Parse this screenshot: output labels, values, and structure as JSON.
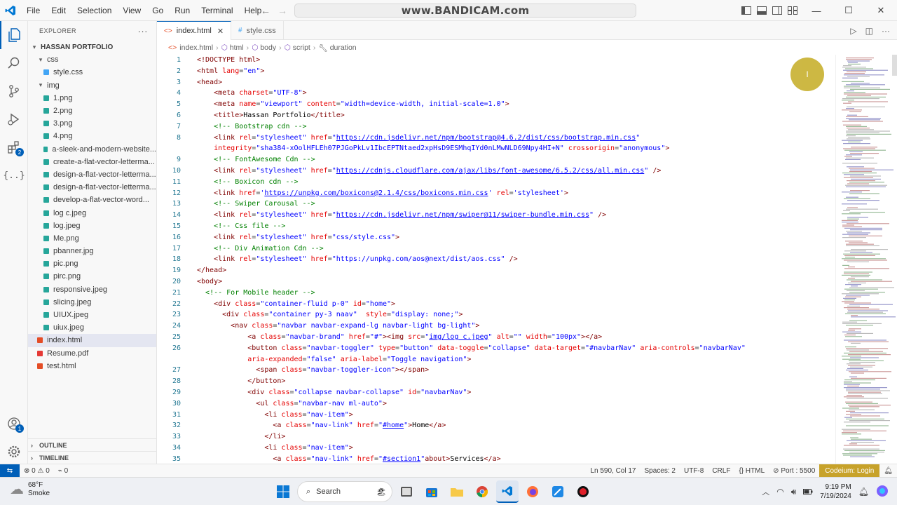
{
  "menu": [
    "File",
    "Edit",
    "Selection",
    "View",
    "Go",
    "Run",
    "Terminal",
    "Help"
  ],
  "watermark": "www.BANDICAM.com",
  "explorer": {
    "title": "EXPLORER",
    "project": "HASSAN PORTFOLIO",
    "tree": [
      {
        "label": "css",
        "type": "folder",
        "depth": 1
      },
      {
        "label": "style.css",
        "type": "css",
        "depth": 2
      },
      {
        "label": "img",
        "type": "folder",
        "depth": 1
      },
      {
        "label": "1.png",
        "type": "img",
        "depth": 2
      },
      {
        "label": "2.png",
        "type": "img",
        "depth": 2
      },
      {
        "label": "3.png",
        "type": "img",
        "depth": 2
      },
      {
        "label": "4.png",
        "type": "img",
        "depth": 2
      },
      {
        "label": "a-sleek-and-modern-website...",
        "type": "img",
        "depth": 2
      },
      {
        "label": "create-a-flat-vector-letterma...",
        "type": "img",
        "depth": 2
      },
      {
        "label": "design-a-flat-vector-letterma...",
        "type": "img",
        "depth": 2
      },
      {
        "label": "design-a-flat-vector-letterma...",
        "type": "img",
        "depth": 2
      },
      {
        "label": "develop-a-flat-vector-word...",
        "type": "img",
        "depth": 2
      },
      {
        "label": "log c.jpeg",
        "type": "img",
        "depth": 2
      },
      {
        "label": "log.jpeg",
        "type": "img",
        "depth": 2
      },
      {
        "label": "Me.png",
        "type": "img",
        "depth": 2
      },
      {
        "label": "pbanner.jpg",
        "type": "img",
        "depth": 2
      },
      {
        "label": "pic.png",
        "type": "img",
        "depth": 2
      },
      {
        "label": "pirc.png",
        "type": "img",
        "depth": 2
      },
      {
        "label": "responsive.jpeg",
        "type": "img",
        "depth": 2
      },
      {
        "label": "slicing.jpeg",
        "type": "img",
        "depth": 2
      },
      {
        "label": "UIUX.jpeg",
        "type": "img",
        "depth": 2
      },
      {
        "label": "uiux.jpeg",
        "type": "img",
        "depth": 2
      },
      {
        "label": "index.html",
        "type": "html",
        "depth": 1,
        "selected": true
      },
      {
        "label": "Resume.pdf",
        "type": "pdf",
        "depth": 1
      },
      {
        "label": "test.html",
        "type": "html",
        "depth": 1
      }
    ],
    "outline": "OUTLINE",
    "timeline": "TIMELINE"
  },
  "tabs": [
    {
      "label": "index.html",
      "active": true
    },
    {
      "label": "style.css",
      "active": false
    }
  ],
  "breadcrumb": [
    "index.html",
    "html",
    "body",
    "script",
    "duration"
  ],
  "code_lines": [
    {
      "n": "1",
      "html": "<span class='c-tag'>&lt;!DOCTYPE html&gt;</span>"
    },
    {
      "n": "2",
      "html": "<span class='c-tag'>&lt;html</span> <span class='c-attr'>lang</span>=<span class='c-str'>\"en\"</span><span class='c-tag'>&gt;</span>"
    },
    {
      "n": "3",
      "html": "<span class='c-tag'>&lt;head&gt;</span>"
    },
    {
      "n": "4",
      "html": "    <span class='c-tag'>&lt;meta</span> <span class='c-attr'>charset</span>=<span class='c-str'>\"UTF-8\"</span><span class='c-tag'>&gt;</span>"
    },
    {
      "n": "5",
      "html": "    <span class='c-tag'>&lt;meta</span> <span class='c-attr'>name</span>=<span class='c-str'>\"viewport\"</span> <span class='c-attr'>content</span>=<span class='c-str'>\"width=device-width, initial-scale=1.0\"</span><span class='c-tag'>&gt;</span>"
    },
    {
      "n": "6",
      "html": "    <span class='c-tag'>&lt;title&gt;</span><span class='c-txt'>Hassan Portfolio</span><span class='c-tag'>&lt;/title&gt;</span>"
    },
    {
      "n": "7",
      "html": "    <span class='c-cmt'>&lt;!-- Bootstrap cdn --&gt;</span>"
    },
    {
      "n": "8",
      "html": "    <span class='c-tag'>&lt;link</span> <span class='c-attr'>rel</span>=<span class='c-str'>\"stylesheet\"</span> <span class='c-attr'>href</span>=<span class='c-str'>\"<span class='c-url'>https://cdn.jsdelivr.net/npm/bootstrap@4.6.2/dist/css/bootstrap.min.css</span>\"</span>"
    },
    {
      "n": "",
      "html": "    <span class='c-attr'>integrity</span>=<span class='c-str'>\"sha384-xOolHFLEh07PJGoPkLv1IbcEPTNtaed2xpHsD9ESMhqIYd0nLMwNLD69Npy4HI+N\"</span> <span class='c-attr'>crossorigin</span>=<span class='c-str'>\"anonymous\"</span><span class='c-tag'>&gt;</span>"
    },
    {
      "n": "9",
      "html": "    <span class='c-cmt'>&lt;!-- FontAwesome Cdn --&gt;</span>"
    },
    {
      "n": "10",
      "html": "    <span class='c-tag'>&lt;link</span> <span class='c-attr'>rel</span>=<span class='c-str'>\"stylesheet\"</span> <span class='c-attr'>href</span>=<span class='c-str'>\"<span class='c-url'>https://cdnjs.cloudflare.com/ajax/libs/font-awesome/6.5.2/css/all.min.css</span>\"</span> <span class='c-tag'>/&gt;</span>"
    },
    {
      "n": "11",
      "html": "    <span class='c-cmt'>&lt;!-- Boxicon cdn --&gt;</span>"
    },
    {
      "n": "12",
      "html": "    <span class='c-tag'>&lt;link</span> <span class='c-attr'>href</span>=<span class='c-str'>'<span class='c-url'>https://unpkg.com/boxicons@2.1.4/css/boxicons.min.css</span>'</span> <span class='c-attr'>rel</span>=<span class='c-str'>'stylesheet'</span><span class='c-tag'>&gt;</span>"
    },
    {
      "n": "13",
      "html": "    <span class='c-cmt'>&lt;!-- Swiper Carousal --&gt;</span>"
    },
    {
      "n": "14",
      "html": "    <span class='c-tag'>&lt;link</span> <span class='c-attr'>rel</span>=<span class='c-str'>\"stylesheet\"</span> <span class='c-attr'>href</span>=<span class='c-str'>\"<span class='c-url'>https://cdn.jsdelivr.net/npm/swiper@11/swiper-bundle.min.css</span>\"</span> <span class='c-tag'>/&gt;</span>"
    },
    {
      "n": "15",
      "html": "    <span class='c-cmt'>&lt;!-- Css file --&gt;</span>"
    },
    {
      "n": "16",
      "html": "    <span class='c-tag'>&lt;link</span> <span class='c-attr'>rel</span>=<span class='c-str'>\"stylesheet\"</span> <span class='c-attr'>href</span>=<span class='c-str'>\"css/style.css\"</span><span class='c-tag'>&gt;</span>"
    },
    {
      "n": "17",
      "html": "    <span class='c-cmt'>&lt;!-- Div Animation Cdn --&gt;</span>"
    },
    {
      "n": "18",
      "html": "    <span class='c-tag'>&lt;link</span> <span class='c-attr'>rel</span>=<span class='c-str'>\"stylesheet\"</span> <span class='c-attr'>href</span>=<span class='c-str'>\"https://unpkg.com/aos@next/dist/aos.css\"</span> <span class='c-tag'>/&gt;</span>"
    },
    {
      "n": "19",
      "html": "<span class='c-tag'>&lt;/head&gt;</span>"
    },
    {
      "n": "20",
      "html": "<span class='c-tag'>&lt;body&gt;</span>"
    },
    {
      "n": "21",
      "html": "  <span class='c-cmt'>&lt;!-- For Mobile header --&gt;</span>"
    },
    {
      "n": "22",
      "html": "    <span class='c-tag'>&lt;div</span> <span class='c-attr'>class</span>=<span class='c-str'>\"container-fluid p-0\"</span> <span class='c-attr'>id</span>=<span class='c-str'>\"home\"</span><span class='c-tag'>&gt;</span>"
    },
    {
      "n": "23",
      "html": "      <span class='c-tag'>&lt;div</span> <span class='c-attr'>class</span>=<span class='c-str'>\"container py-3 naav\"</span>  <span class='c-attr'>style</span>=<span class='c-str'>\"display: none;\"</span><span class='c-tag'>&gt;</span>"
    },
    {
      "n": "24",
      "html": "        <span class='c-tag'>&lt;nav</span> <span class='c-attr'>class</span>=<span class='c-str'>\"navbar navbar-expand-lg navbar-light bg-light\"</span><span class='c-tag'>&gt;</span>"
    },
    {
      "n": "25",
      "html": "            <span class='c-tag'>&lt;a</span> <span class='c-attr'>class</span>=<span class='c-str'>\"navbar-brand\"</span> <span class='c-attr'>href</span>=<span class='c-str'>\"#\"</span><span class='c-tag'>&gt;&lt;img</span> <span class='c-attr'>src</span>=<span class='c-str'>\"<span class='c-url'>img/log c.jpeg</span>\"</span> <span class='c-attr'>alt</span>=<span class='c-str'>\"\"</span> <span class='c-attr'>width</span>=<span class='c-str'>\"100px\"</span><span class='c-tag'>&gt;&lt;/a&gt;</span>"
    },
    {
      "n": "26",
      "html": "            <span class='c-tag'>&lt;button</span> <span class='c-attr'>class</span>=<span class='c-str'>\"navbar-toggler\"</span> <span class='c-attr'>type</span>=<span class='c-str'>\"button\"</span> <span class='c-attr'>data-toggle</span>=<span class='c-str'>\"collapse\"</span> <span class='c-attr'>data-target</span>=<span class='c-str'>\"#navbarNav\"</span> <span class='c-attr'>aria-controls</span>=<span class='c-str'>\"navbarNav\"</span>"
    },
    {
      "n": "",
      "html": "            <span class='c-attr'>aria-expanded</span>=<span class='c-str'>\"false\"</span> <span class='c-attr'>aria-label</span>=<span class='c-str'>\"Toggle navigation\"</span><span class='c-tag'>&gt;</span>"
    },
    {
      "n": "27",
      "html": "              <span class='c-tag'>&lt;span</span> <span class='c-attr'>class</span>=<span class='c-str'>\"navbar-toggler-icon\"</span><span class='c-tag'>&gt;&lt;/span&gt;</span>"
    },
    {
      "n": "28",
      "html": "            <span class='c-tag'>&lt;/button&gt;</span>"
    },
    {
      "n": "29",
      "html": "            <span class='c-tag'>&lt;div</span> <span class='c-attr'>class</span>=<span class='c-str'>\"collapse navbar-collapse\"</span> <span class='c-attr'>id</span>=<span class='c-str'>\"navbarNav\"</span><span class='c-tag'>&gt;</span>"
    },
    {
      "n": "30",
      "html": "              <span class='c-tag'>&lt;ul</span> <span class='c-attr'>class</span>=<span class='c-str'>\"navbar-nav ml-auto\"</span><span class='c-tag'>&gt;</span>"
    },
    {
      "n": "31",
      "html": "                <span class='c-tag'>&lt;li</span> <span class='c-attr'>class</span>=<span class='c-str'>\"nav-item\"</span><span class='c-tag'>&gt;</span>"
    },
    {
      "n": "32",
      "html": "                  <span class='c-tag'>&lt;a</span> <span class='c-attr'>class</span>=<span class='c-str'>\"nav-link\"</span> <span class='c-attr'>href</span>=<span class='c-str'>\"<span class='c-url'>#home</span>\"</span><span class='c-tag'>&gt;</span><span class='c-txt'>Home</span><span class='c-tag'>&lt;/a&gt;</span>"
    },
    {
      "n": "33",
      "html": "                <span class='c-tag'>&lt;/li&gt;</span>"
    },
    {
      "n": "34",
      "html": "                <span class='c-tag'>&lt;li</span> <span class='c-attr'>class</span>=<span class='c-str'>\"nav-item\"</span><span class='c-tag'>&gt;</span>"
    },
    {
      "n": "35",
      "html": "                  <span class='c-tag'>&lt;a</span> <span class='c-attr'>class</span>=<span class='c-str'>\"nav-link\"</span> <span class='c-attr'>href</span>=<span class='c-str'>\"<span class='c-url'>#section1</span>\"</span><span class='c-tag'>about&gt;</span><span class='c-txt'>Services</span><span class='c-tag'>&lt;/a&gt;</span>"
    }
  ],
  "status": {
    "errors": "0",
    "warnings": "0",
    "ports_forwarded": "0",
    "position": "Ln 590, Col 17",
    "spaces": "Spaces: 2",
    "encoding": "UTF-8",
    "eol": "CRLF",
    "language": "HTML",
    "port": "Port : 5500",
    "codeium": "Codeium: Login"
  },
  "taskbar": {
    "temperature": "68°F",
    "condition": "Smoke",
    "search_label": "Search",
    "time": "9:19 PM",
    "date": "7/19/2024"
  },
  "colors": {
    "accent": "#005fb8",
    "codeium": "#c7a22a",
    "cursor_highlight": "#c9b234"
  }
}
